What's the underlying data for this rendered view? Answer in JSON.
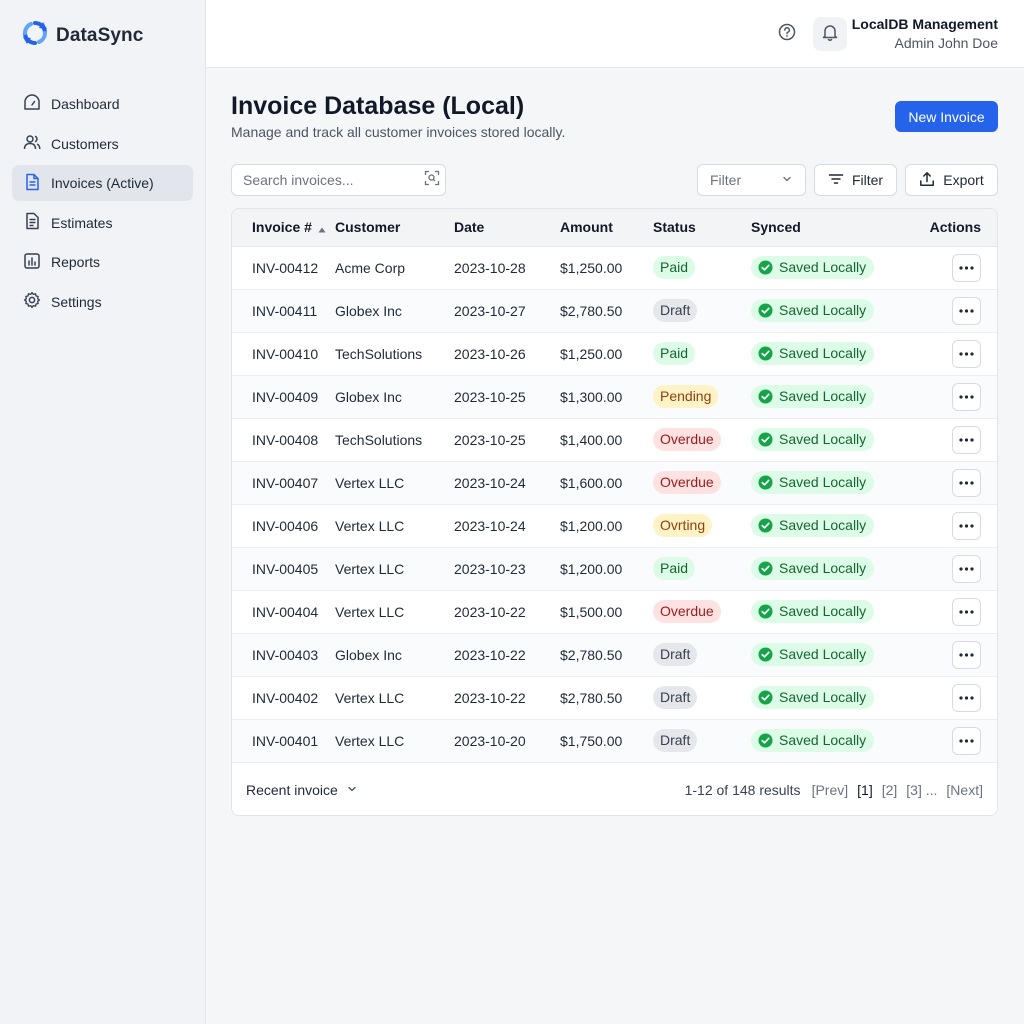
{
  "app": {
    "name": "DataSync",
    "accent": "#2563eb"
  },
  "sidebar": {
    "items": [
      {
        "label": "Dashboard",
        "icon": "dashboard-icon",
        "active": false
      },
      {
        "label": "Customers",
        "icon": "users-icon",
        "active": false
      },
      {
        "label": "Invoices (Active)",
        "icon": "document-icon",
        "active": true
      },
      {
        "label": "Estimates",
        "icon": "document-lines-icon",
        "active": false
      },
      {
        "label": "Reports",
        "icon": "chart-icon",
        "active": false
      },
      {
        "label": "Settings",
        "icon": "gear-icon",
        "active": false
      }
    ]
  },
  "topbar": {
    "user_title": "LocalDB Management",
    "user_sub": "Admin John Doe"
  },
  "header": {
    "title": "Invoice Database (Local)",
    "subtitle": "Manage and track all customer invoices stored locally.",
    "new_button": "New Invoice"
  },
  "toolbar": {
    "search_placeholder": "Search invoices...",
    "filter_select": "Filter",
    "filter_button": "Filter",
    "export_button": "Export"
  },
  "table": {
    "columns": [
      "Invoice #",
      "Customer",
      "Date",
      "Amount",
      "Status",
      "Synced",
      "Actions"
    ],
    "rows": [
      {
        "invoice": "INV-00412",
        "customer": "Acme Corp",
        "date": "2023-10-28",
        "amount": "$1,250.00",
        "status": "Paid",
        "status_kind": "paid",
        "synced": "Saved Locally"
      },
      {
        "invoice": "INV-00411",
        "customer": "Globex Inc",
        "date": "2023-10-27",
        "amount": "$2,780.50",
        "status": "Draft",
        "status_kind": "draft",
        "synced": "Saved Locally"
      },
      {
        "invoice": "INV-00410",
        "customer": "TechSolutions",
        "date": "2023-10-26",
        "amount": "$1,250.00",
        "status": "Paid",
        "status_kind": "paid",
        "synced": "Saved Locally"
      },
      {
        "invoice": "INV-00409",
        "customer": "Globex Inc",
        "date": "2023-10-25",
        "amount": "$1,300.00",
        "status": "Pending",
        "status_kind": "pending",
        "synced": "Saved Locally"
      },
      {
        "invoice": "INV-00408",
        "customer": "TechSolutions",
        "date": "2023-10-25",
        "amount": "$1,400.00",
        "status": "Overdue",
        "status_kind": "overdue",
        "synced": "Saved Locally"
      },
      {
        "invoice": "INV-00407",
        "customer": "Vertex LLC",
        "date": "2023-10-24",
        "amount": "$1,600.00",
        "status": "Overdue",
        "status_kind": "overdue",
        "synced": "Saved Locally"
      },
      {
        "invoice": "INV-00406",
        "customer": "Vertex LLC",
        "date": "2023-10-24",
        "amount": "$1,200.00",
        "status": "Ovrting",
        "status_kind": "ovrting",
        "synced": "Saved Locally"
      },
      {
        "invoice": "INV-00405",
        "customer": "Vertex LLC",
        "date": "2023-10-23",
        "amount": "$1,200.00",
        "status": "Paid",
        "status_kind": "paid",
        "synced": "Saved Locally"
      },
      {
        "invoice": "INV-00404",
        "customer": "Vertex LLC",
        "date": "2023-10-22",
        "amount": "$1,500.00",
        "status": "Overdue",
        "status_kind": "overdue",
        "synced": "Saved Locally"
      },
      {
        "invoice": "INV-00403",
        "customer": "Globex Inc",
        "date": "2023-10-22",
        "amount": "$2,780.50",
        "status": "Draft",
        "status_kind": "draft",
        "synced": "Saved Locally"
      },
      {
        "invoice": "INV-00402",
        "customer": "Vertex LLC",
        "date": "2023-10-22",
        "amount": "$2,780.50",
        "status": "Draft",
        "status_kind": "draft",
        "synced": "Saved Locally"
      },
      {
        "invoice": "INV-00401",
        "customer": "Vertex LLC",
        "date": "2023-10-20",
        "amount": "$1,750.00",
        "status": "Draft",
        "status_kind": "draft",
        "synced": "Saved Locally"
      }
    ]
  },
  "footer": {
    "recent_label": "Recent invoice",
    "summary": "1-12 of 148 results",
    "prev": "[Prev]",
    "pages": [
      "[1]",
      "[2]",
      "[3] ..."
    ],
    "next": "[Next]"
  }
}
